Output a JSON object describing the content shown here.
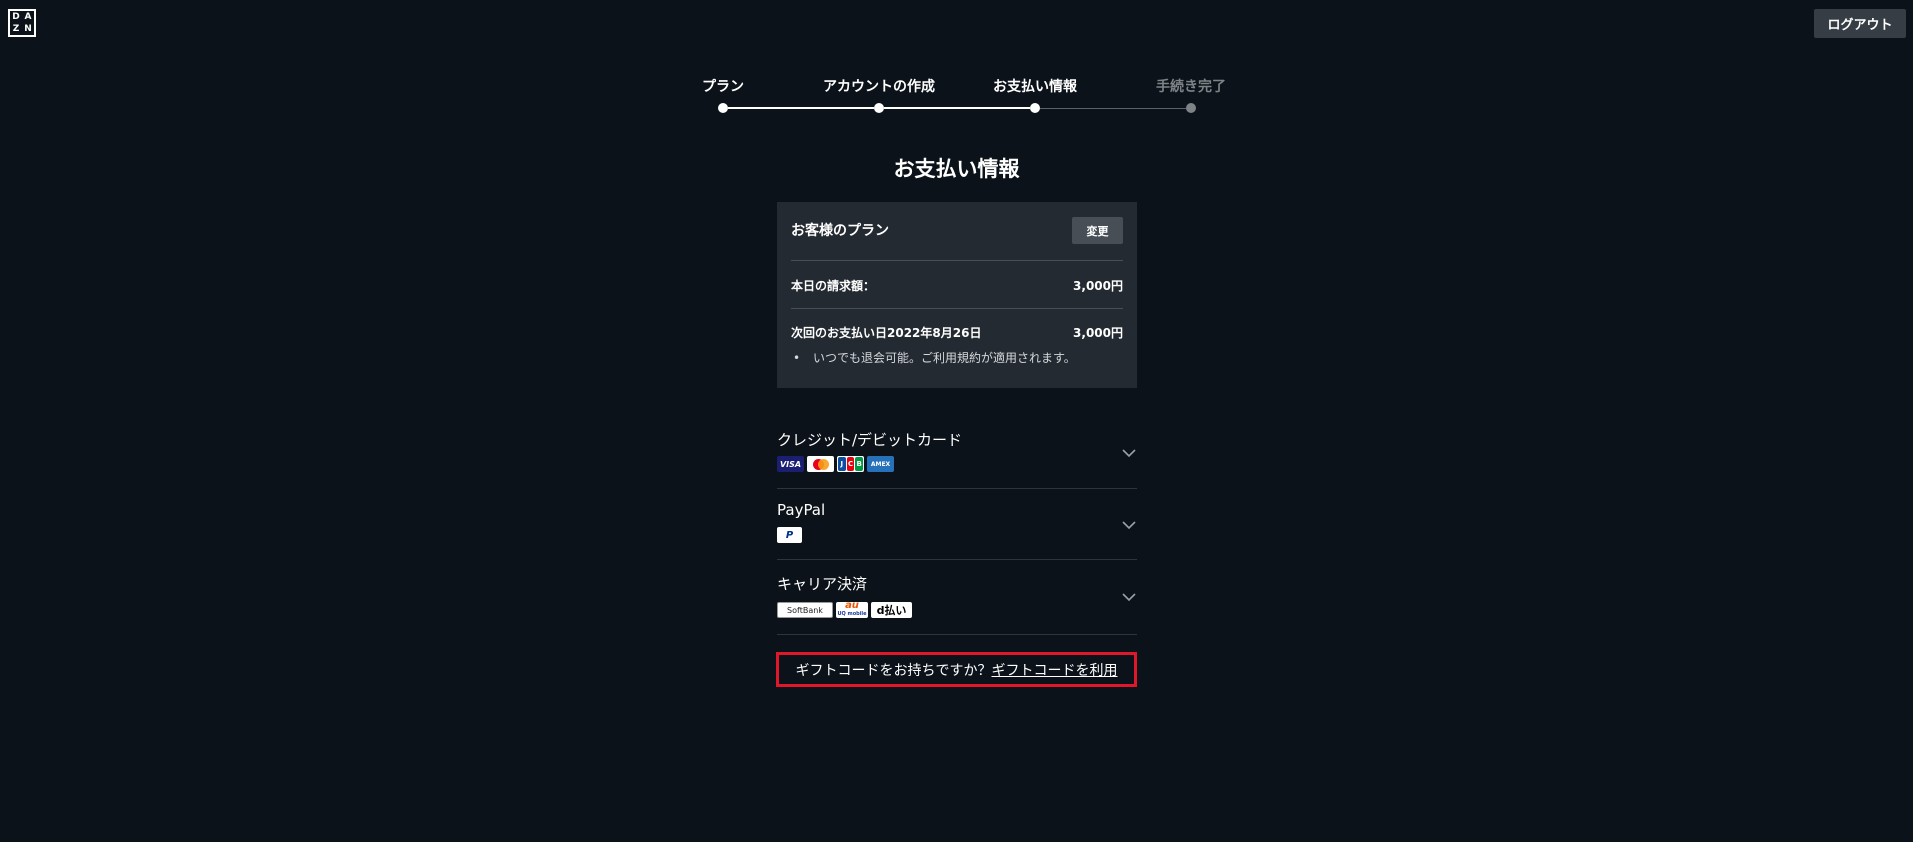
{
  "header": {
    "logo_letters": [
      "D",
      "A",
      "Z",
      "N"
    ],
    "logout_label": "ログアウト"
  },
  "stepper": {
    "steps": [
      {
        "label": "プラン",
        "state": "done"
      },
      {
        "label": "アカウントの作成",
        "state": "done"
      },
      {
        "label": "お支払い情報",
        "state": "current"
      },
      {
        "label": "手続き完了",
        "state": "upcoming"
      }
    ]
  },
  "page_title": "お支払い情報",
  "plan": {
    "title": "お客様のプラン",
    "change_label": "変更",
    "today_label": "本日の請求額：",
    "today_amount": "3,000円",
    "next_label": "次回のお支払い日2022年8月26日",
    "next_amount": "3,000円",
    "note_bullet": "•",
    "note": "いつでも退会可能。ご利用規約が適用されます。"
  },
  "payment_methods": [
    {
      "label": "クレジット/デビットカード",
      "logos": [
        "VISA",
        "Mastercard",
        "JCB",
        "AMERICAN EXPRESS"
      ]
    },
    {
      "label": "PayPal",
      "logos": [
        "P"
      ]
    },
    {
      "label": "キャリア決済",
      "logos": [
        "SoftBank",
        "au",
        "UQ mobile",
        "d払い"
      ]
    }
  ],
  "gift": {
    "question": "ギフトコードをお持ちですか？",
    "link_label": "ギフトコードを利用"
  },
  "colors": {
    "background": "#0c1219",
    "panel": "#232a31",
    "button": "#363d44",
    "highlight_border": "#e0162b",
    "muted_step": "#7d8387"
  }
}
